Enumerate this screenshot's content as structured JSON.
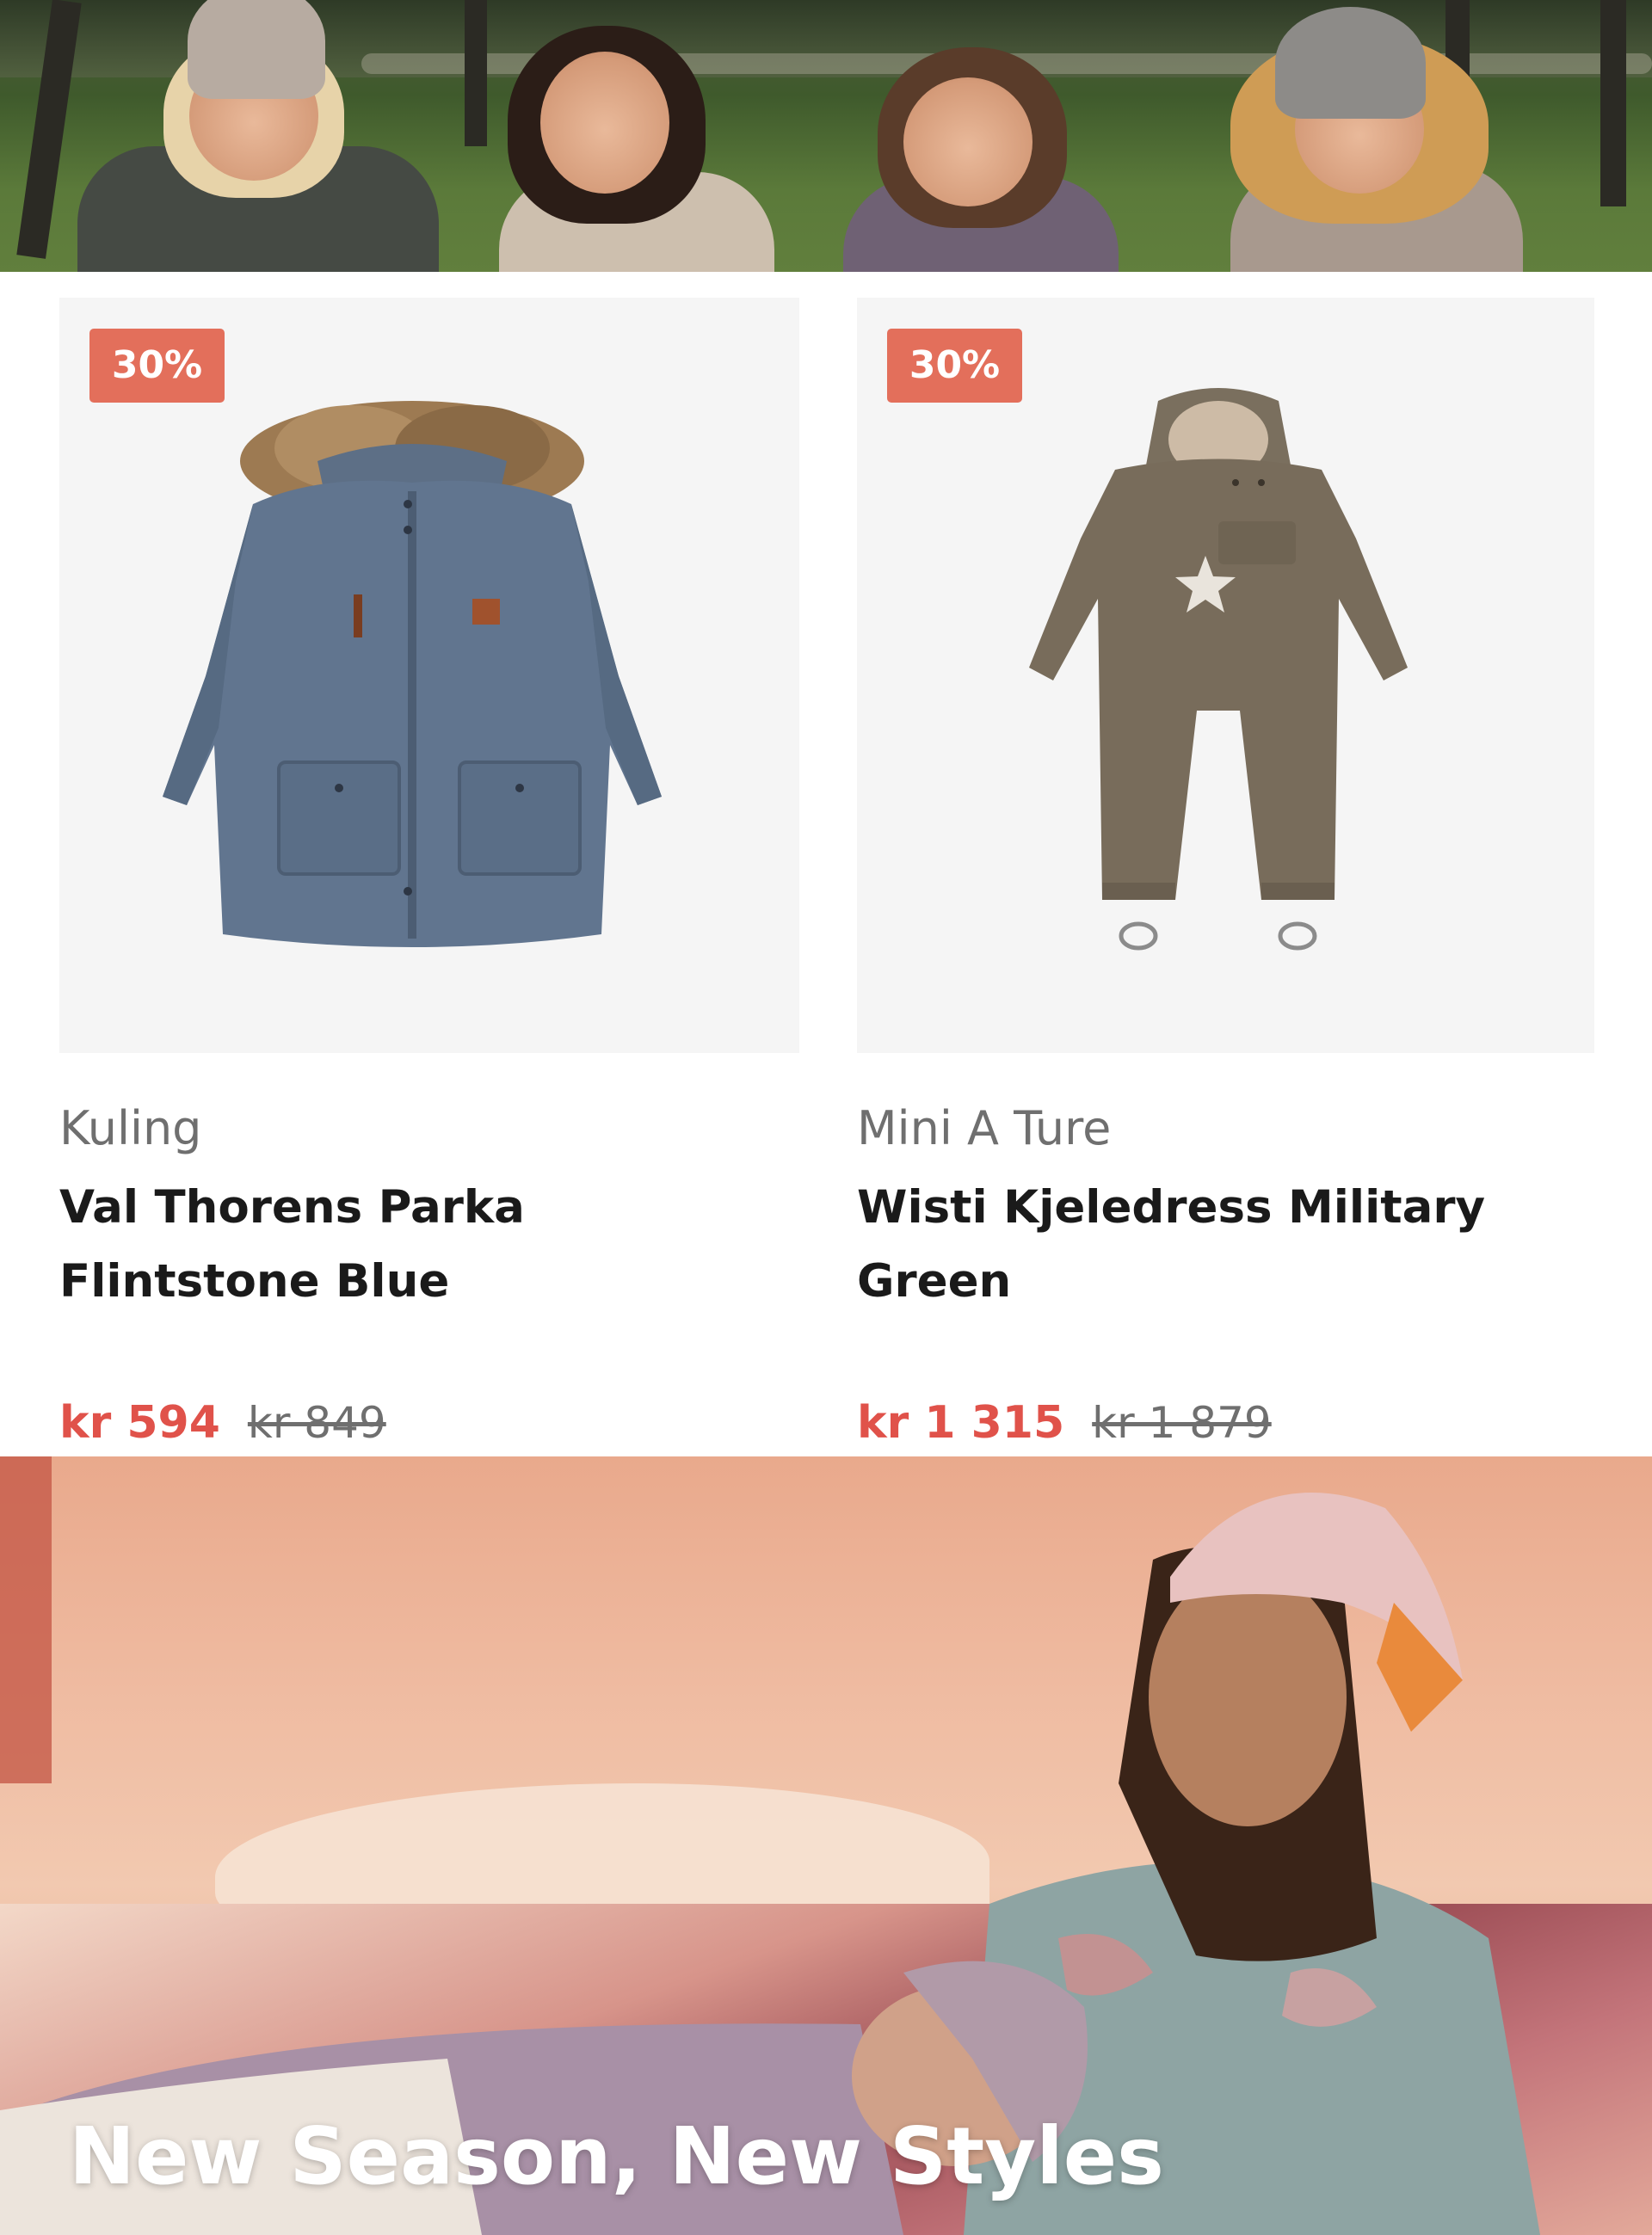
{
  "hero_top": {
    "image": "kids-running-outdoors-photo"
  },
  "products": [
    {
      "badge": "30%",
      "image": "parka-jacket-image",
      "brand": "Kuling",
      "title": "Val Thorens Parka Flintstone Blue",
      "price_now": "kr 594",
      "price_old": "kr 849"
    },
    {
      "badge": "30%",
      "image": "snowsuit-image",
      "brand": "Mini A Ture",
      "title": "Wisti Kjeledress Military Green",
      "price_now": "kr 1 315",
      "price_old": "kr 1 879"
    }
  ],
  "hero_bottom": {
    "image": "girls-in-floral-clothes-photo",
    "headline": "New Season, New Styles"
  },
  "colors": {
    "badge": "#e36f5b",
    "price_sale": "#e0524a",
    "muted_text": "#6f6f6f",
    "title_text": "#1a1a1a",
    "image_bg": "#f5f5f5"
  }
}
